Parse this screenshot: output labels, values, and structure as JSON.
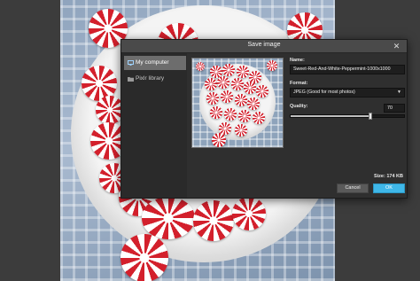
{
  "dialog": {
    "title": "Save image",
    "close_symbol": "✕"
  },
  "sources": [
    {
      "label": "My computer",
      "icon": "monitor-icon",
      "selected": true
    },
    {
      "label": "Pixlr library",
      "icon": "folder-icon",
      "selected": false
    }
  ],
  "form": {
    "name_label": "Name:",
    "name_value": "Sweet-Red-And-White-Peppermint-1000x1000",
    "format_label": "Format:",
    "format_value": "JPEG (Good for most photos)",
    "quality_label": "Quality:",
    "quality_value": "70",
    "quality_fraction": 0.7
  },
  "size_text": "Size: 174 KB",
  "buttons": {
    "cancel": "Cancel",
    "ok": "OK"
  },
  "colors": {
    "accent": "#3fb7e8",
    "dialog_bg": "#2f2f2f",
    "selected_source": "#6d6d6d"
  }
}
